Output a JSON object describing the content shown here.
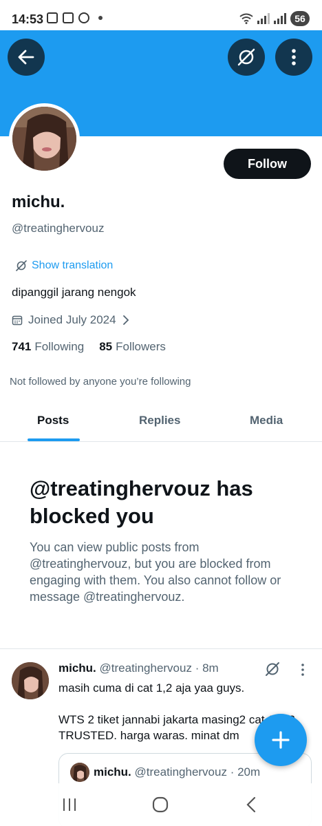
{
  "status_bar": {
    "time": "14:53",
    "battery": "56"
  },
  "profile": {
    "display_name": "michu.",
    "handle": "@treatinghervouz",
    "show_translation": "Show translation",
    "bio": "dipanggil jarang nengok",
    "joined": "Joined July 2024",
    "following_count": "741",
    "following_label": "Following",
    "followers_count": "85",
    "followers_label": "Followers",
    "not_followed": "Not followed by anyone you’re following",
    "follow_button": "Follow"
  },
  "tabs": [
    {
      "label": "Posts",
      "active": true
    },
    {
      "label": "Replies",
      "active": false
    },
    {
      "label": "Media",
      "active": false
    }
  ],
  "blocked": {
    "title": "@treatinghervouz has blocked you",
    "text": "You can view public posts from @treatinghervouz, but you are blocked from engaging with them. You also cannot follow or message @treatinghervouz."
  },
  "post": {
    "name": "michu.",
    "meta": "@treatinghervouz · 8m",
    "text": "masih cuma di cat 1,2 aja yaa guys.\n\nWTS 2 tiket jannabi jakarta masing2 cat 1 & 2. TRUSTED. harga waras. minat dm",
    "quote": {
      "name": "michu.",
      "meta": "@treatinghervouz · 20m"
    }
  },
  "colors": {
    "accent": "#1d9bf0",
    "text": "#0f1419",
    "secondary": "#536471",
    "follow_bg": "#0f1419"
  }
}
